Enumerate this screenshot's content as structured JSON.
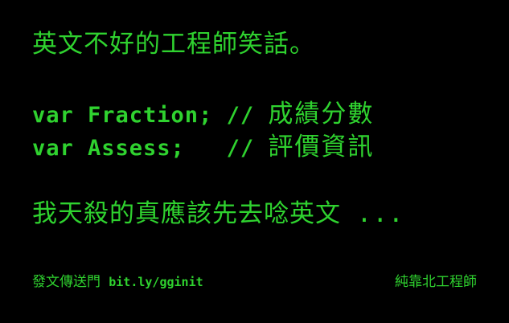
{
  "title": "英文不好的工程師笑話。",
  "code_lines": [
    {
      "code": "var Fraction; // ",
      "comment": "成績分數"
    },
    {
      "code": "var Assess;   // ",
      "comment": "評價資訊"
    }
  ],
  "lament": "我天殺的真應該先去唸英文 ...",
  "footer": {
    "left_label": "發文傳送門",
    "left_url": "bit.ly/gginit",
    "right": "純靠北工程師"
  },
  "colors": {
    "background": "#000000",
    "text": "#2fd22f"
  }
}
